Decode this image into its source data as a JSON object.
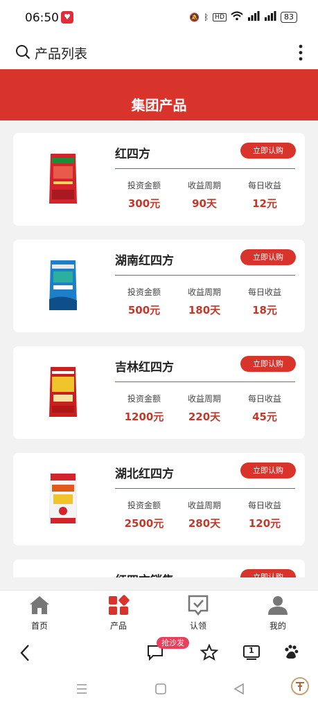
{
  "status_bar": {
    "time": "06:50",
    "battery": "83"
  },
  "app_bar": {
    "title": "产品列表"
  },
  "banner": {
    "title": "集团产品"
  },
  "labels": {
    "invest": "投资金额",
    "period": "收益周期",
    "daily": "每日收益",
    "buy": "立即认购"
  },
  "products": [
    {
      "name": "红四方",
      "invest": "300元",
      "period": "90天",
      "daily": "12元",
      "bag_color": "#d4242b",
      "band_color": "#1a8f3a"
    },
    {
      "name": "湖南红四方",
      "invest": "500元",
      "period": "180天",
      "daily": "18元",
      "bag_color": "#1e7fc9",
      "band_color": "#e8e8e8"
    },
    {
      "name": "吉林红四方",
      "invest": "1200元",
      "period": "220天",
      "daily": "45元",
      "bag_color": "#c8201f",
      "band_color": "#f0c42a"
    },
    {
      "name": "湖北红四方",
      "invest": "2500元",
      "period": "280天",
      "daily": "120元",
      "bag_color": "#f4f4f4",
      "band_color": "#e05a1a"
    },
    {
      "name": "红四方销售",
      "buy": "立即认购"
    }
  ],
  "tabs": [
    {
      "label": "首页",
      "icon": "home-icon",
      "active": false
    },
    {
      "label": "产品",
      "icon": "product-grid-icon",
      "active": true
    },
    {
      "label": "认领",
      "icon": "claim-check-icon",
      "active": false
    },
    {
      "label": "我的",
      "icon": "profile-icon",
      "active": false
    }
  ],
  "browser_bar": {
    "hot_badge": "抢沙发",
    "page_count": "1"
  },
  "colors": {
    "accent": "#d9342c",
    "value_red": "#c0392b"
  }
}
